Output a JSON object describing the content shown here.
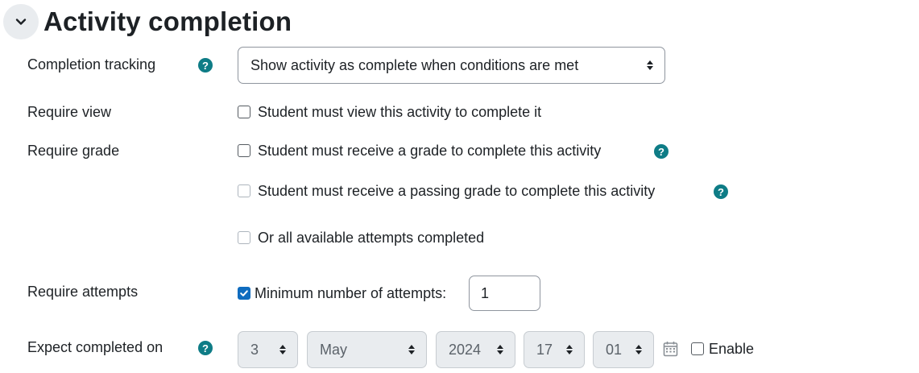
{
  "section": {
    "title": "Activity completion",
    "collapse_icon": "chevron-down-icon"
  },
  "completion_tracking": {
    "label": "Completion tracking",
    "value": "Show activity as complete when conditions are met",
    "help_icon": "question-circle-icon"
  },
  "require_view": {
    "label": "Require view",
    "checkbox_label": "Student must view this activity to complete it",
    "checked": false
  },
  "require_grade": {
    "label": "Require grade",
    "receive_grade_label": "Student must receive a grade to complete this activity",
    "passing_grade_label": "Student must receive a passing grade to complete this activity",
    "all_attempts_label": "Or all available attempts completed"
  },
  "require_attempts": {
    "label": "Require attempts",
    "checkbox_label": "Minimum number of attempts:",
    "checked": true,
    "value": "1"
  },
  "expect_completed": {
    "label": "Expect completed on",
    "day": "3",
    "month": "May",
    "year": "2024",
    "hour": "17",
    "minute": "01",
    "enable_label": "Enable",
    "calendar_icon": "calendar-icon"
  },
  "colors": {
    "help_icon": "#0e7c86",
    "checkbox_checked": "#0f6cbf",
    "disabled_select_bg": "#e9ecef"
  }
}
